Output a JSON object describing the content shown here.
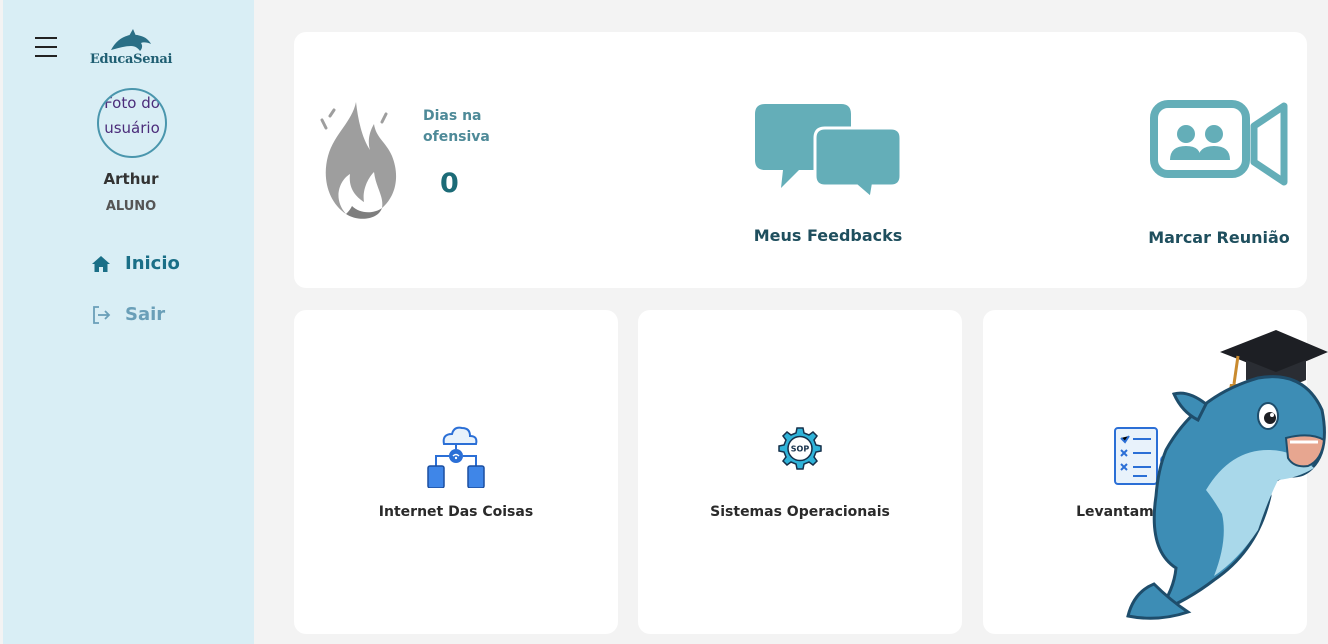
{
  "sidebar": {
    "logo_text": "EducaSenai",
    "avatar_alt": "Foto do usuário",
    "user_name": "Arthur",
    "user_role": "ALUNO",
    "nav": [
      {
        "label": "Inicio",
        "icon": "home-icon"
      },
      {
        "label": "Sair",
        "icon": "logout-icon"
      }
    ]
  },
  "dashboard": {
    "streak_label": "Dias na ofensiva",
    "streak_value": "0",
    "feedback_label": "Meus Feedbacks",
    "meeting_label": "Marcar Reunião"
  },
  "courses": [
    {
      "title": "Internet Das Coisas",
      "icon": "iot-icon"
    },
    {
      "title": "Sistemas Operacionais",
      "icon": "sop-gear-icon"
    },
    {
      "title": "Levantamento de",
      "icon": "requirements-doc-icon"
    }
  ],
  "colors": {
    "sidebar_bg": "#d9eef5",
    "accent": "#64aeb8",
    "nav_active": "#1a6f87",
    "nav_inactive": "#6a9fb8",
    "heading": "#1f4f5e"
  }
}
